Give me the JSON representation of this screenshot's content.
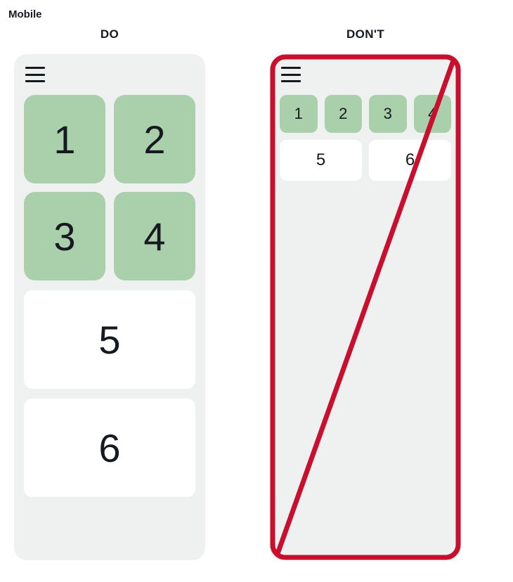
{
  "section_label": "Mobile",
  "do": {
    "label": "DO",
    "tiles_green": [
      "1",
      "2",
      "3",
      "4"
    ],
    "tiles_white": [
      "5",
      "6"
    ]
  },
  "dont": {
    "label": "DON'T",
    "tiles_green": [
      "1",
      "2",
      "3",
      "4"
    ],
    "tiles_white": [
      "5",
      "6"
    ]
  },
  "colors": {
    "tile_green": "#aacfab",
    "phone_bg": "#eff0f0",
    "frame_red": "#c8102e"
  }
}
